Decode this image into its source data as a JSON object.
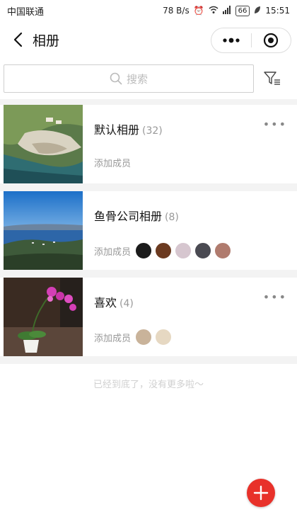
{
  "status_bar": {
    "carrier": "中国联通",
    "speed": "78 B/s",
    "battery": "66",
    "time": "15:51"
  },
  "nav": {
    "title": "相册"
  },
  "search": {
    "placeholder": "搜索"
  },
  "albums": [
    {
      "name": "默认相册",
      "count": "(32)",
      "add_member": "添加成员",
      "has_more": true,
      "members": []
    },
    {
      "name": "鱼骨公司相册",
      "count": "(8)",
      "add_member": "添加成员",
      "has_more": false,
      "members": [
        "#1b1b1b",
        "#6b3a20",
        "#d6c6cf",
        "#4a4a52",
        "#b07b6e"
      ]
    },
    {
      "name": "喜欢",
      "count": "(4)",
      "add_member": "添加成员",
      "has_more": true,
      "members": [
        "#c9b39a",
        "#e6d8c2"
      ]
    }
  ],
  "footer": {
    "end_text": "已经到底了，没有更多啦～"
  },
  "colors": {
    "accent": "#e8312a"
  }
}
